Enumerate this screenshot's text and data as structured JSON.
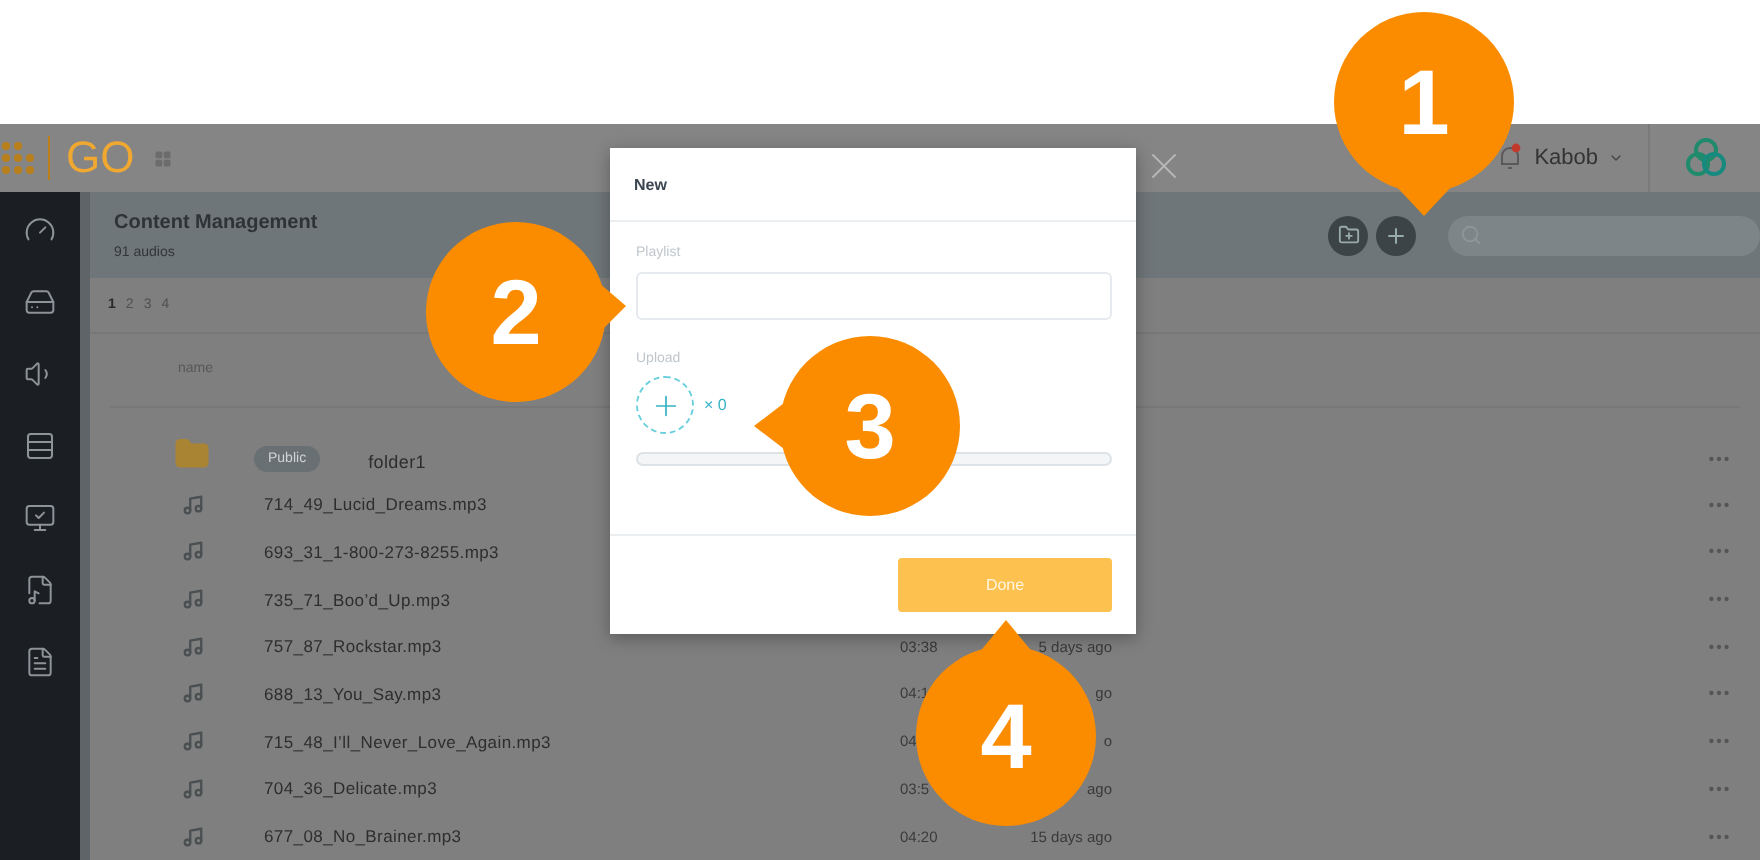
{
  "header": {
    "brand": "GO",
    "user": "Kabob",
    "notification": true
  },
  "page": {
    "title": "Content Management",
    "subtitle": "91 audios"
  },
  "pagination": [
    {
      "label": "1",
      "selected": true
    },
    {
      "label": "2",
      "selected": false
    },
    {
      "label": "3",
      "selected": false
    },
    {
      "label": "4",
      "selected": false
    }
  ],
  "table": {
    "columns": [
      "name"
    ],
    "rows": [
      {
        "kind": "folder",
        "badge": "Public",
        "name": "folder1"
      },
      {
        "kind": "audio",
        "name": "714_49_Lucid_Dreams.mp3"
      },
      {
        "kind": "audio",
        "name": "693_31_1-800-273-8255.mp3"
      },
      {
        "kind": "audio",
        "name": "735_71_Boo’d_Up.mp3"
      },
      {
        "kind": "audio",
        "name": "757_87_Rockstar.mp3",
        "time": "03:38",
        "date": "5 days ago"
      },
      {
        "kind": "audio",
        "name": "688_13_You_Say.mp3",
        "time": "04:1",
        "date": "go"
      },
      {
        "kind": "audio",
        "name": "715_48_I’ll_Never_Love_Again.mp3",
        "time": "04",
        "date": "o"
      },
      {
        "kind": "audio",
        "name": "704_36_Delicate.mp3",
        "time": "03:5",
        "date": "ago"
      },
      {
        "kind": "audio",
        "name": "677_08_No_Brainer.mp3",
        "time": "04:20",
        "date": "15 days ago"
      }
    ]
  },
  "dialog": {
    "title": "New",
    "playlist_label": "Playlist",
    "upload_label": "Upload",
    "upload_count": "× 0",
    "progress": {
      "level": 0
    },
    "button": "Done"
  },
  "callouts": [
    "1",
    "2",
    "3",
    "4"
  ]
}
